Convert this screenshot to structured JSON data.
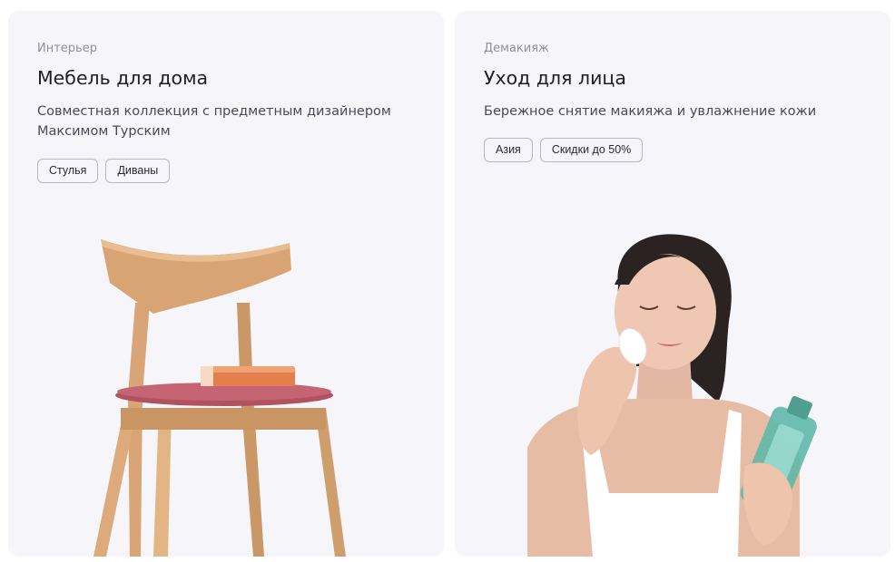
{
  "cards": [
    {
      "eyebrow": "Интерьер",
      "title": "Мебель для дома",
      "description_line1": "Совместная коллекция с предметным дизайнером",
      "description_line2": "Максимом Турским",
      "chips": [
        "Стулья",
        "Диваны"
      ],
      "image": "wooden-chair-with-book"
    },
    {
      "eyebrow": "Демакияж",
      "title": "Уход для лица",
      "description_line1": "Бережное снятие макияжа и увлажнение кожи",
      "chips": [
        "Азия",
        "Скидки до 50%"
      ],
      "image": "woman-removing-makeup"
    }
  ]
}
